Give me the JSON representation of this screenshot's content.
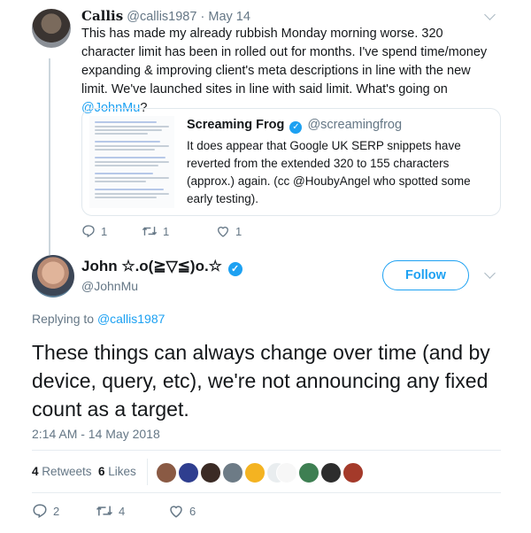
{
  "reply_parent": {
    "display_name": "Callis",
    "handle": "@callis1987",
    "separator": "·",
    "date": "May 14",
    "text_before_mention": "This has made my already rubbish Monday morning worse. 320 character limit has been in rolled out for months. I've spend time/money expanding & improving client's meta descriptions in line with the new limit. We've launched sites in line with said limit. What's going on ",
    "mention": "@JohnMu",
    "text_after_mention": "?",
    "quoted": {
      "name": "Screaming Frog",
      "handle": "@screamingfrog",
      "text": "It does appear that Google UK SERP snippets have reverted from the extended 320 to 155 characters (approx.) again. (cc @HoubyAngel who spotted some early testing)."
    },
    "actions": {
      "replies": "1",
      "retweets": "1",
      "likes": "1"
    }
  },
  "main_tweet": {
    "display_name": "John ☆.o(≧▽≦)o.☆",
    "handle": "@JohnMu",
    "follow_label": "Follow",
    "replying_label": "Replying to ",
    "replying_handle": "@callis1987",
    "text": "These things can always change over time (and by device, query, etc), we're not announcing any fixed count as a target.",
    "timestamp": "2:14 AM - 14 May 2018",
    "retweets_count": "4",
    "retweets_label": "Retweets",
    "likes_count": "6",
    "likes_label": "Likes",
    "actions": {
      "replies": "2",
      "retweets": "4",
      "likes": "6"
    }
  },
  "colors": {
    "accent": "#1da1f2",
    "secondary_text": "#657786",
    "divider": "#e6ecf0"
  },
  "icons": [
    "reply-icon",
    "retweet-icon",
    "like-icon",
    "verified-badge-icon",
    "chevron-down-icon"
  ]
}
